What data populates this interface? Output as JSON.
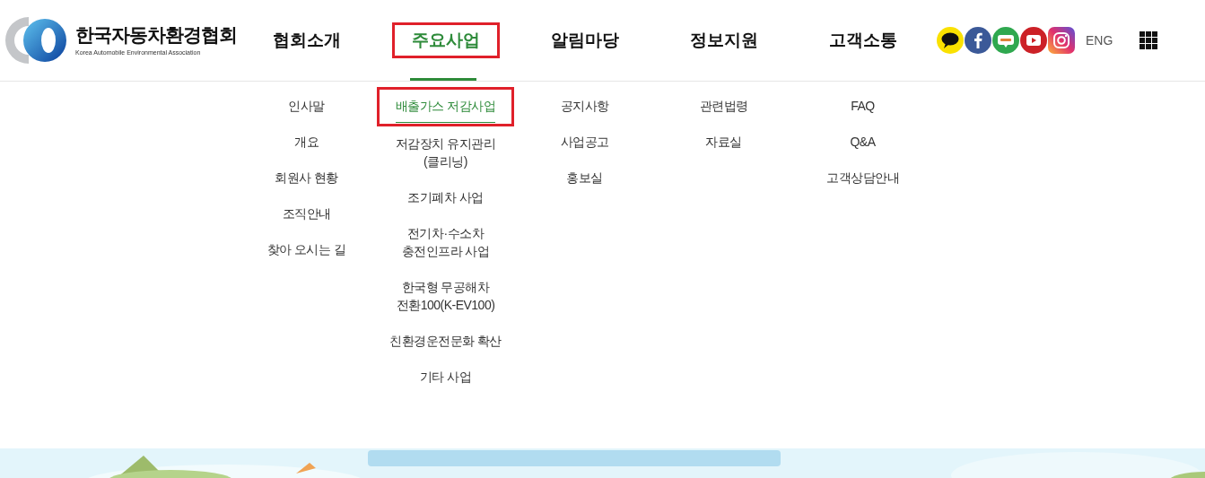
{
  "logo": {
    "title": "한국자동차환경협회",
    "subtitle": "Korea Automobile Environmental Association"
  },
  "nav": [
    {
      "label": "협회소개",
      "selected": false,
      "highlighted": false,
      "submenu": [
        {
          "label": "인사말",
          "selected": false,
          "highlighted": false
        },
        {
          "label": "개요",
          "selected": false,
          "highlighted": false
        },
        {
          "label": "회원사 현황",
          "selected": false,
          "highlighted": false
        },
        {
          "label": "조직안내",
          "selected": false,
          "highlighted": false
        },
        {
          "label": "찾아 오시는 길",
          "selected": false,
          "highlighted": false
        }
      ]
    },
    {
      "label": "주요사업",
      "selected": true,
      "highlighted": true,
      "submenu": [
        {
          "label": "배출가스 저감사업",
          "selected": true,
          "highlighted": true
        },
        {
          "label": "저감장치 유지관리\n(클리닝)",
          "selected": false,
          "highlighted": false
        },
        {
          "label": "조기폐차 사업",
          "selected": false,
          "highlighted": false
        },
        {
          "label": "전기차·수소차\n충전인프라 사업",
          "selected": false,
          "highlighted": false
        },
        {
          "label": "한국형 무공해차\n전환100(K-EV100)",
          "selected": false,
          "highlighted": false
        },
        {
          "label": "친환경운전문화 확산",
          "selected": false,
          "highlighted": false
        },
        {
          "label": "기타 사업",
          "selected": false,
          "highlighted": false
        }
      ]
    },
    {
      "label": "알림마당",
      "selected": false,
      "highlighted": false,
      "submenu": [
        {
          "label": "공지사항",
          "selected": false,
          "highlighted": false
        },
        {
          "label": "사업공고",
          "selected": false,
          "highlighted": false
        },
        {
          "label": "홍보실",
          "selected": false,
          "highlighted": false
        }
      ]
    },
    {
      "label": "정보지원",
      "selected": false,
      "highlighted": false,
      "submenu": [
        {
          "label": "관련법령",
          "selected": false,
          "highlighted": false
        },
        {
          "label": "자료실",
          "selected": false,
          "highlighted": false
        }
      ]
    },
    {
      "label": "고객소통",
      "selected": false,
      "highlighted": false,
      "submenu": [
        {
          "label": "FAQ",
          "selected": false,
          "highlighted": false
        },
        {
          "label": "Q&A",
          "selected": false,
          "highlighted": false
        },
        {
          "label": "고객상담안내",
          "selected": false,
          "highlighted": false
        }
      ]
    }
  ],
  "social": [
    {
      "kind": "kakao"
    },
    {
      "kind": "facebook"
    },
    {
      "kind": "blog"
    },
    {
      "kind": "youtube"
    },
    {
      "kind": "instagram"
    }
  ],
  "language": "ENG"
}
